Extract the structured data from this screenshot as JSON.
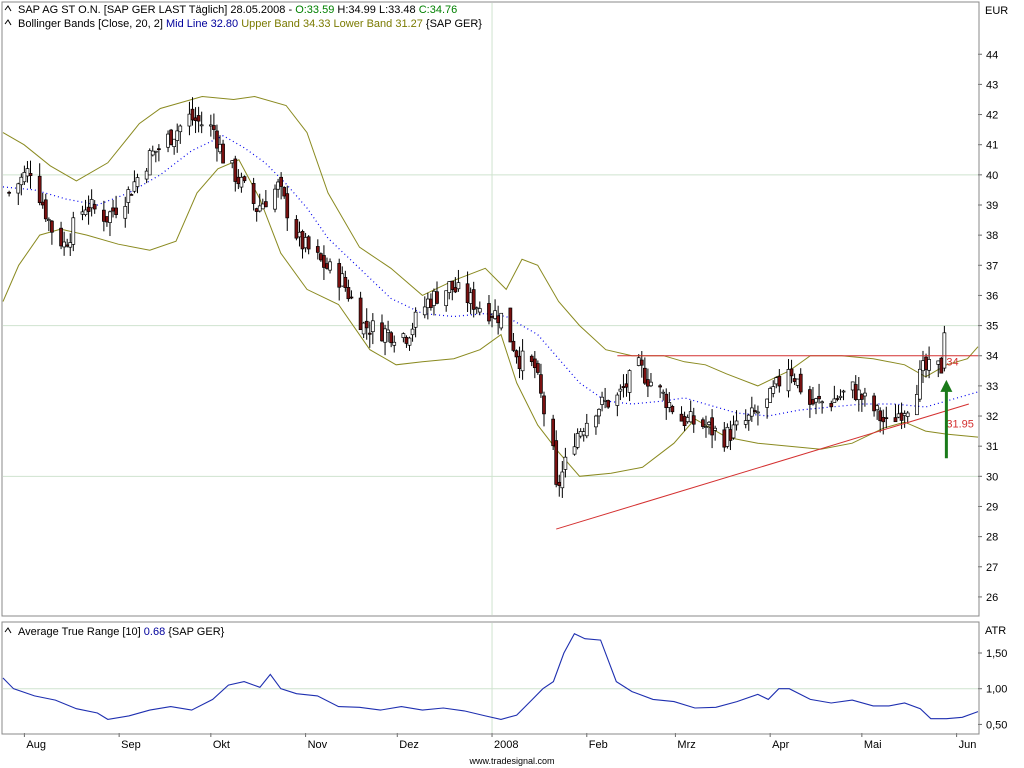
{
  "header": {
    "main_legend_parts": [
      {
        "text": "SAP AG ST O.N. [SAP GER LAST Täglich] 28.05.2008 - ",
        "color": "#000000"
      },
      {
        "text": "O:33.59",
        "color": "#008000"
      },
      {
        "text": " H:34.99 L:33.48 ",
        "color": "#000000"
      },
      {
        "text": "C:34.76",
        "color": "#008000"
      }
    ],
    "bb_legend_parts": [
      {
        "text": "Bollinger Bands [Close, 20, 2] ",
        "color": "#000000"
      },
      {
        "text": "Mid Line 32.80",
        "color": "#00009c"
      },
      {
        "text": " Upper Band 34.33 Lower Band 31.27",
        "color": "#7a7a00"
      },
      {
        "text": " {SAP GER}",
        "color": "#000000"
      }
    ],
    "atr_legend_parts": [
      {
        "text": "Average True Range [10] ",
        "color": "#000000"
      },
      {
        "text": "0.68",
        "color": "#00009c"
      },
      {
        "text": " {SAP GER}",
        "color": "#000000"
      }
    ]
  },
  "footer": {
    "source": "www.tradesignal.com"
  },
  "colors": {
    "grid": "#cfe3cf",
    "frame": "#888888",
    "up": "#ffffff",
    "down": "#7a1010",
    "band": "#8a8a20",
    "mid": "#0000ee",
    "trend": "#d43030",
    "arrow": "#1a7a1a",
    "atr": "#1e2fb0"
  },
  "chart_data": [
    {
      "type": "candlestick",
      "title": "SAP AG ST O.N. [SAP GER LAST Täglich]",
      "y_unit": "EUR",
      "ylim": [
        25.4,
        45.7
      ],
      "y_ticks": [
        26,
        27,
        28,
        29,
        30,
        31,
        32,
        33,
        34,
        35,
        36,
        37,
        38,
        39,
        40,
        41,
        42,
        43,
        44
      ],
      "x_ticks": [
        {
          "label": "Aug",
          "date": "2007-08-01"
        },
        {
          "label": "Sep",
          "date": "2007-09-01"
        },
        {
          "label": "Okt",
          "date": "2007-10-01"
        },
        {
          "label": "Nov",
          "date": "2007-11-01"
        },
        {
          "label": "Dez",
          "date": "2007-12-01"
        },
        {
          "label": "2008",
          "date": "2008-01-01"
        },
        {
          "label": "Feb",
          "date": "2008-02-01"
        },
        {
          "label": "Mrz",
          "date": "2008-03-01"
        },
        {
          "label": "Apr",
          "date": "2008-04-01"
        },
        {
          "label": "Mai",
          "date": "2008-05-01"
        },
        {
          "label": "Jun",
          "date": "2008-06-01"
        }
      ],
      "last_bar": {
        "date": "2008-05-28",
        "open": 33.59,
        "high": 34.99,
        "low": 33.48,
        "close": 34.76
      },
      "close_profile": [
        [
          "2007-07-27",
          39.4
        ],
        [
          "2007-08-03",
          40.2
        ],
        [
          "2007-08-10",
          38.2
        ],
        [
          "2007-08-14",
          37.7
        ],
        [
          "2007-08-21",
          39.0
        ],
        [
          "2007-08-28",
          38.6
        ],
        [
          "2007-09-04",
          39.4
        ],
        [
          "2007-09-11",
          40.6
        ],
        [
          "2007-09-18",
          41.3
        ],
        [
          "2007-09-24",
          41.9
        ],
        [
          "2007-10-02",
          41.5
        ],
        [
          "2007-10-05",
          40.6
        ],
        [
          "2007-10-09",
          40.0
        ],
        [
          "2007-10-16",
          38.9
        ],
        [
          "2007-10-23",
          39.6
        ],
        [
          "2007-10-30",
          37.8
        ],
        [
          "2007-11-06",
          37.1
        ],
        [
          "2007-11-13",
          36.5
        ],
        [
          "2007-11-20",
          35.0
        ],
        [
          "2007-11-27",
          34.8
        ],
        [
          "2007-12-04",
          34.7
        ],
        [
          "2007-12-11",
          35.8
        ],
        [
          "2007-12-18",
          36.3
        ],
        [
          "2007-12-27",
          35.7
        ],
        [
          "2008-01-04",
          35.3
        ],
        [
          "2008-01-10",
          33.9
        ],
        [
          "2008-01-15",
          33.6
        ],
        [
          "2008-01-21",
          30.7
        ],
        [
          "2008-01-22",
          29.5
        ],
        [
          "2008-01-28",
          31.3
        ],
        [
          "2008-02-04",
          32.3
        ],
        [
          "2008-02-11",
          32.6
        ],
        [
          "2008-02-18",
          33.6
        ],
        [
          "2008-02-25",
          32.8
        ],
        [
          "2008-03-03",
          31.9
        ],
        [
          "2008-03-10",
          31.7
        ],
        [
          "2008-03-17",
          31.3
        ],
        [
          "2008-03-24",
          31.8
        ],
        [
          "2008-03-31",
          32.4
        ],
        [
          "2008-04-07",
          33.7
        ],
        [
          "2008-04-14",
          32.4
        ],
        [
          "2008-04-21",
          32.5
        ],
        [
          "2008-04-28",
          32.9
        ],
        [
          "2008-05-05",
          32.2
        ],
        [
          "2008-05-09",
          31.7
        ],
        [
          "2008-05-16",
          32.4
        ],
        [
          "2008-05-21",
          33.5
        ],
        [
          "2008-05-27",
          33.6
        ],
        [
          "2008-05-28",
          34.76
        ]
      ],
      "bollinger": {
        "upper": [
          [
            0,
            41.4
          ],
          [
            20,
            41.0
          ],
          [
            45,
            40.3
          ],
          [
            70,
            39.8
          ],
          [
            100,
            40.4
          ],
          [
            130,
            41.7
          ],
          [
            150,
            42.2
          ],
          [
            190,
            42.6
          ],
          [
            220,
            42.5
          ],
          [
            240,
            42.6
          ],
          [
            270,
            42.3
          ],
          [
            290,
            41.4
          ],
          [
            310,
            39.4
          ],
          [
            340,
            37.6
          ],
          [
            370,
            36.9
          ],
          [
            400,
            36.0
          ],
          [
            430,
            36.5
          ],
          [
            460,
            36.9
          ],
          [
            480,
            36.2
          ],
          [
            495,
            37.2
          ],
          [
            510,
            37.0
          ],
          [
            530,
            35.8
          ],
          [
            550,
            35.0
          ],
          [
            575,
            34.2
          ],
          [
            600,
            34.0
          ],
          [
            630,
            34.0
          ],
          [
            650,
            33.8
          ],
          [
            670,
            33.7
          ],
          [
            690,
            33.4
          ],
          [
            720,
            33.0
          ],
          [
            750,
            33.5
          ],
          [
            770,
            34.0
          ],
          [
            800,
            34.0
          ],
          [
            830,
            33.9
          ],
          [
            860,
            33.7
          ],
          [
            880,
            33.3
          ],
          [
            900,
            33.7
          ],
          [
            920,
            33.9
          ],
          [
            930,
            34.3
          ]
        ],
        "mid": [
          [
            0,
            39.6
          ],
          [
            30,
            39.5
          ],
          [
            60,
            39.2
          ],
          [
            90,
            39.0
          ],
          [
            120,
            39.4
          ],
          [
            150,
            40.0
          ],
          [
            180,
            40.8
          ],
          [
            210,
            41.3
          ],
          [
            230,
            40.9
          ],
          [
            250,
            40.4
          ],
          [
            270,
            39.7
          ],
          [
            290,
            38.9
          ],
          [
            310,
            37.9
          ],
          [
            340,
            36.9
          ],
          [
            370,
            35.9
          ],
          [
            400,
            35.4
          ],
          [
            430,
            35.3
          ],
          [
            460,
            35.4
          ],
          [
            480,
            35.3
          ],
          [
            510,
            34.7
          ],
          [
            530,
            33.9
          ],
          [
            550,
            33.1
          ],
          [
            575,
            32.5
          ],
          [
            600,
            32.4
          ],
          [
            630,
            32.5
          ],
          [
            650,
            32.6
          ],
          [
            680,
            32.3
          ],
          [
            700,
            32.1
          ],
          [
            730,
            32.0
          ],
          [
            760,
            32.2
          ],
          [
            790,
            32.3
          ],
          [
            820,
            32.4
          ],
          [
            850,
            32.4
          ],
          [
            880,
            32.3
          ],
          [
            900,
            32.5
          ],
          [
            930,
            32.8
          ]
        ],
        "lower": [
          [
            0,
            35.8
          ],
          [
            15,
            37.0
          ],
          [
            35,
            38.0
          ],
          [
            55,
            38.2
          ],
          [
            80,
            38.0
          ],
          [
            110,
            37.7
          ],
          [
            140,
            37.5
          ],
          [
            165,
            37.8
          ],
          [
            185,
            39.4
          ],
          [
            205,
            40.2
          ],
          [
            225,
            40.5
          ],
          [
            245,
            39.2
          ],
          [
            265,
            37.4
          ],
          [
            290,
            36.2
          ],
          [
            320,
            35.7
          ],
          [
            350,
            34.2
          ],
          [
            375,
            33.7
          ],
          [
            400,
            33.8
          ],
          [
            430,
            33.9
          ],
          [
            455,
            34.2
          ],
          [
            475,
            34.7
          ],
          [
            490,
            33.1
          ],
          [
            510,
            31.7
          ],
          [
            530,
            30.8
          ],
          [
            550,
            30.0
          ],
          [
            580,
            30.1
          ],
          [
            610,
            30.3
          ],
          [
            640,
            31.1
          ],
          [
            660,
            31.9
          ],
          [
            690,
            31.3
          ],
          [
            720,
            31.1
          ],
          [
            750,
            31.0
          ],
          [
            780,
            30.9
          ],
          [
            810,
            31.1
          ],
          [
            840,
            31.6
          ],
          [
            860,
            31.8
          ],
          [
            880,
            31.5
          ],
          [
            900,
            31.4
          ],
          [
            930,
            31.3
          ]
        ]
      },
      "resistance_line": {
        "from": [
          "2008-02-11",
          34.0
        ],
        "to": [
          "2008-05-28",
          34.0
        ]
      },
      "support_trendline": {
        "from": [
          "2008-01-22",
          28.25
        ],
        "to": [
          "2008-06-05",
          32.4
        ]
      },
      "annotations": [
        {
          "label": "34",
          "value": 34.0,
          "color": "#d43030"
        },
        {
          "label": "31.95",
          "value": 31.95,
          "color": "#d43030"
        },
        {
          "label": "arrow",
          "from": 30.6,
          "to": 33.2,
          "color": "#1a7a1a"
        }
      ]
    },
    {
      "type": "line",
      "title": "Average True Range [10]",
      "y_unit": "ATR",
      "ylim": [
        0.38,
        1.92
      ],
      "y_tick_labels": [
        {
          "value": 1.5,
          "label": "1,50"
        },
        {
          "value": 1.0,
          "label": "1,00"
        },
        {
          "value": 0.5,
          "label": "0,50"
        }
      ],
      "series": [
        {
          "name": "Average True Range [10]",
          "values": [
            [
              0,
              1.15
            ],
            [
              10,
              1.0
            ],
            [
              30,
              0.9
            ],
            [
              50,
              0.84
            ],
            [
              70,
              0.72
            ],
            [
              90,
              0.66
            ],
            [
              100,
              0.57
            ],
            [
              120,
              0.62
            ],
            [
              140,
              0.7
            ],
            [
              160,
              0.75
            ],
            [
              180,
              0.7
            ],
            [
              200,
              0.85
            ],
            [
              215,
              1.05
            ],
            [
              230,
              1.1
            ],
            [
              245,
              1.02
            ],
            [
              255,
              1.2
            ],
            [
              265,
              1.0
            ],
            [
              280,
              0.93
            ],
            [
              300,
              0.9
            ],
            [
              320,
              0.75
            ],
            [
              340,
              0.74
            ],
            [
              360,
              0.7
            ],
            [
              380,
              0.75
            ],
            [
              400,
              0.7
            ],
            [
              420,
              0.73
            ],
            [
              440,
              0.69
            ],
            [
              460,
              0.62
            ],
            [
              475,
              0.57
            ],
            [
              490,
              0.63
            ],
            [
              505,
              0.85
            ],
            [
              515,
              1.0
            ],
            [
              525,
              1.1
            ],
            [
              535,
              1.5
            ],
            [
              545,
              1.77
            ],
            [
              555,
              1.7
            ],
            [
              570,
              1.68
            ],
            [
              585,
              1.1
            ],
            [
              600,
              0.96
            ],
            [
              620,
              0.85
            ],
            [
              640,
              0.82
            ],
            [
              660,
              0.73
            ],
            [
              680,
              0.74
            ],
            [
              700,
              0.82
            ],
            [
              720,
              0.92
            ],
            [
              730,
              0.85
            ],
            [
              740,
              1.0
            ],
            [
              750,
              1.0
            ],
            [
              770,
              0.85
            ],
            [
              790,
              0.8
            ],
            [
              810,
              0.84
            ],
            [
              830,
              0.76
            ],
            [
              845,
              0.76
            ],
            [
              860,
              0.8
            ],
            [
              875,
              0.72
            ],
            [
              885,
              0.58
            ],
            [
              900,
              0.58
            ],
            [
              915,
              0.6
            ],
            [
              930,
              0.68
            ]
          ]
        }
      ]
    }
  ]
}
